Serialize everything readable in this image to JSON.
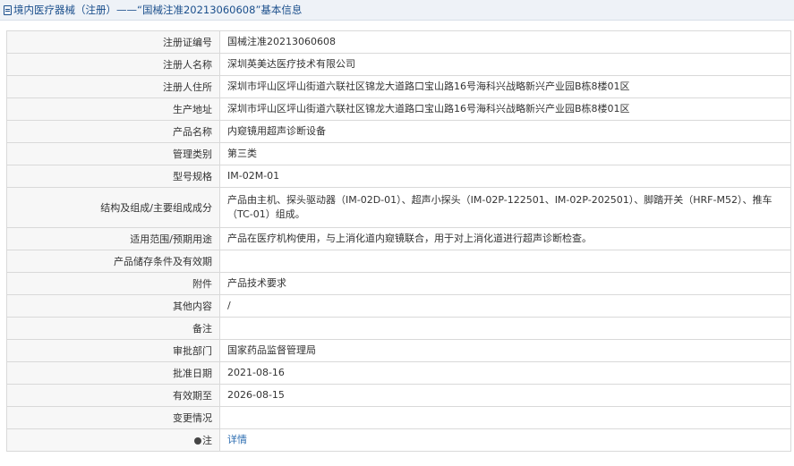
{
  "header": {
    "title": "境内医疗器械（注册）——“国械注准20213060608”基本信息",
    "icon": "document-icon"
  },
  "rows": [
    {
      "label": "注册证编号",
      "value": "国械注准20213060608"
    },
    {
      "label": "注册人名称",
      "value": "深圳英美达医疗技术有限公司"
    },
    {
      "label": "注册人住所",
      "value": "深圳市坪山区坪山街道六联社区锦龙大道路口宝山路16号海科兴战略新兴产业园B栋8楼01区"
    },
    {
      "label": "生产地址",
      "value": "深圳市坪山区坪山街道六联社区锦龙大道路口宝山路16号海科兴战略新兴产业园B栋8楼01区"
    },
    {
      "label": "产品名称",
      "value": "内窥镜用超声诊断设备"
    },
    {
      "label": "管理类别",
      "value": "第三类"
    },
    {
      "label": "型号规格",
      "value": "IM-02M-01"
    },
    {
      "label": "结构及组成/主要组成成分",
      "value": "产品由主机、探头驱动器（IM-02D-01）、超声小探头（IM-02P-122501、IM-02P-202501）、脚踏开关（HRF-M52）、推车（TC-01）组成。"
    },
    {
      "label": "适用范围/预期用途",
      "value": "产品在医疗机构使用，与上消化道内窥镜联合，用于对上消化道进行超声诊断检查。"
    },
    {
      "label": "产品储存条件及有效期",
      "value": ""
    },
    {
      "label": "附件",
      "value": "产品技术要求"
    },
    {
      "label": "其他内容",
      "value": "/"
    },
    {
      "label": "备注",
      "value": ""
    },
    {
      "label": "审批部门",
      "value": "国家药品监督管理局"
    },
    {
      "label": "批准日期",
      "value": "2021-08-16"
    },
    {
      "label": "有效期至",
      "value": "2026-08-15"
    },
    {
      "label": "变更情况",
      "value": ""
    }
  ],
  "note": {
    "label": "注",
    "link": "详情",
    "icon": "note-dot-icon"
  }
}
